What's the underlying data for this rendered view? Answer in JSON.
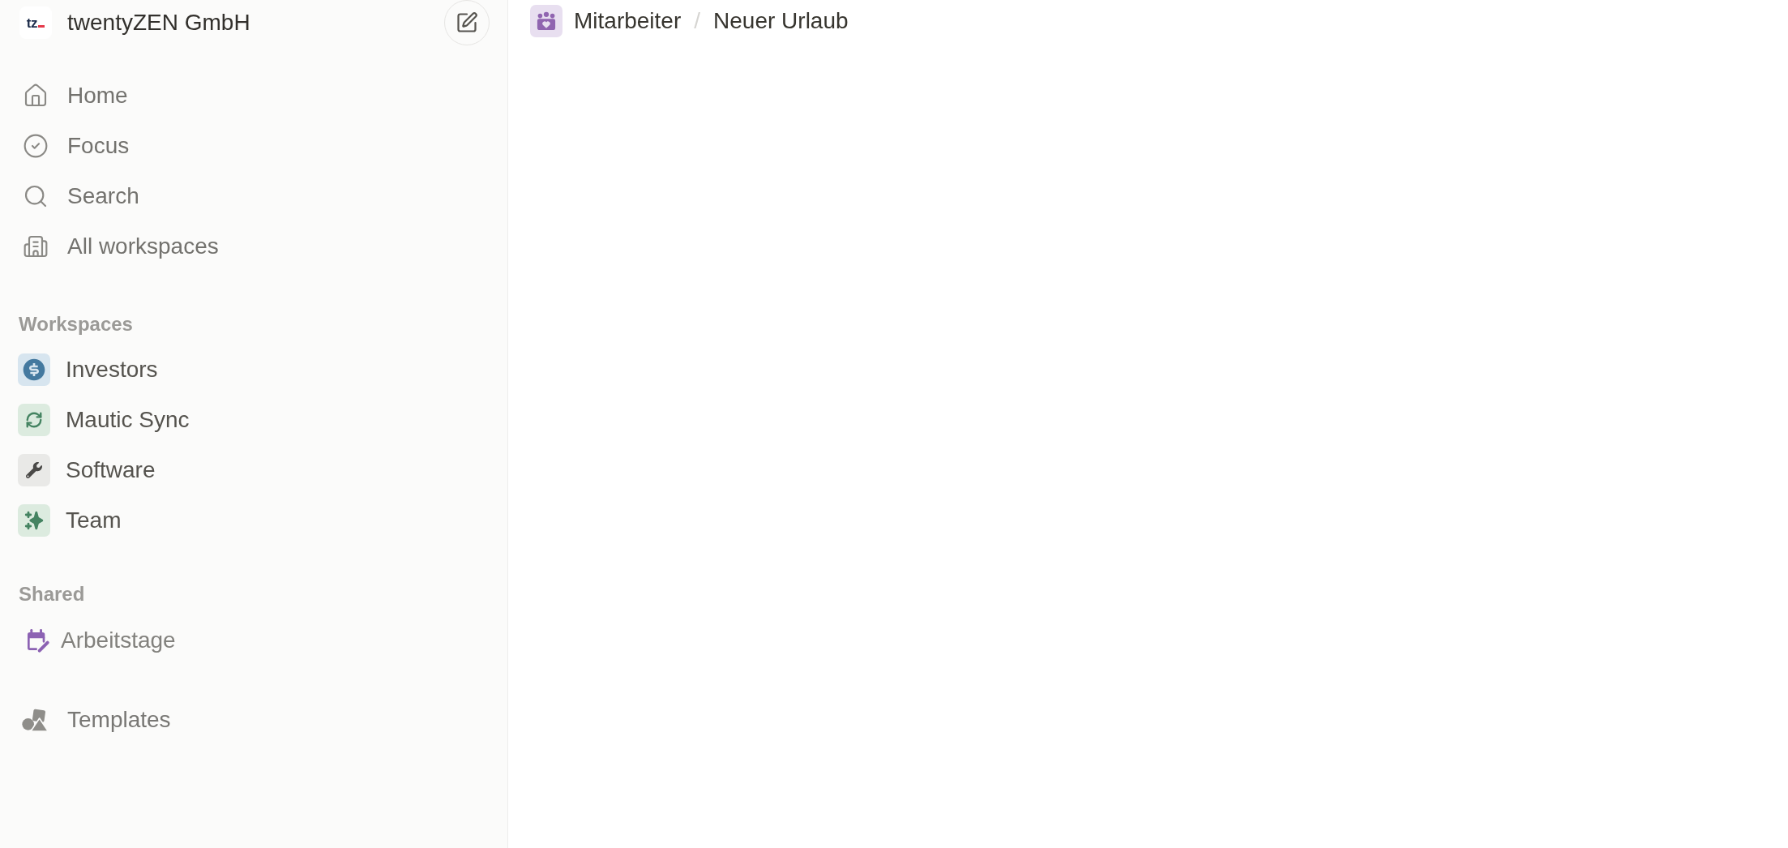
{
  "sidebar": {
    "workspace": {
      "logo": "tz",
      "name": "twentyZEN GmbH"
    },
    "nav": [
      {
        "label": "Home"
      },
      {
        "label": "Focus"
      },
      {
        "label": "Search"
      },
      {
        "label": "All workspaces"
      }
    ],
    "sections": [
      {
        "title": "Workspaces",
        "items": [
          {
            "label": "Investors"
          },
          {
            "label": "Mautic Sync"
          },
          {
            "label": "Software"
          },
          {
            "label": "Team"
          }
        ]
      },
      {
        "title": "Shared",
        "items": [
          {
            "label": "Arbeitstage"
          }
        ]
      }
    ],
    "footer_items": [
      {
        "label": "Templates"
      }
    ]
  },
  "breadcrumb": {
    "items": [
      {
        "label": "Mitarbeiter"
      },
      {
        "label": "Neuer Urlaub"
      }
    ],
    "separator": "/"
  }
}
